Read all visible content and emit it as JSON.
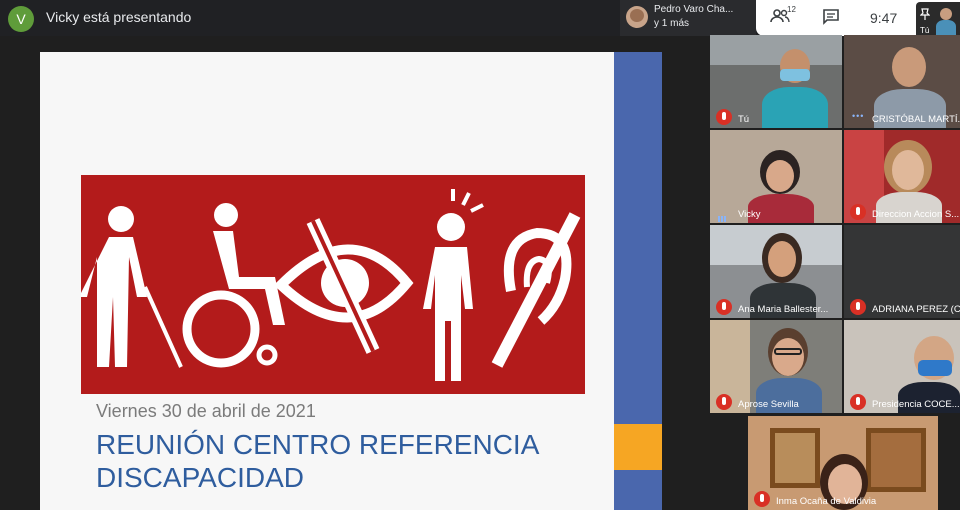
{
  "header": {
    "presenter_initial": "V",
    "presenting_text": "Vicky está presentando",
    "presenter_chip_name": "Pedro Varo Cha...",
    "presenter_chip_more": "y 1 más",
    "participant_count": "12",
    "time": "9:47",
    "self_label": "Tú"
  },
  "slide": {
    "date": "Viernes 30 de abril de 2021",
    "title_line1": "REUNIÓN CENTRO REFERENCIA",
    "title_line2": "DISCAPACIDAD"
  },
  "participants": [
    {
      "name": "Tú",
      "muted": true
    },
    {
      "name": "CRISTÓBAL MARTÍ...",
      "muted": false
    },
    {
      "name": "Vicky",
      "muted": false,
      "speaking": true
    },
    {
      "name": "Direccion Accion S...",
      "muted": true
    },
    {
      "name": "Ana Maria Ballester...",
      "muted": true
    },
    {
      "name": "ADRIANA PEREZ (C...",
      "muted": true
    },
    {
      "name": "Aprose Sevilla",
      "muted": true
    },
    {
      "name": "Presidencia COCE...",
      "muted": true
    },
    {
      "name": "Inma Ocaña de Valdivia",
      "muted": true
    }
  ],
  "colors": {
    "accent_blue": "#4a67ad",
    "accent_orange": "#f6a623",
    "banner_red": "#b31b1b",
    "title_blue": "#2f5d9e",
    "mute_red": "#d93025"
  }
}
